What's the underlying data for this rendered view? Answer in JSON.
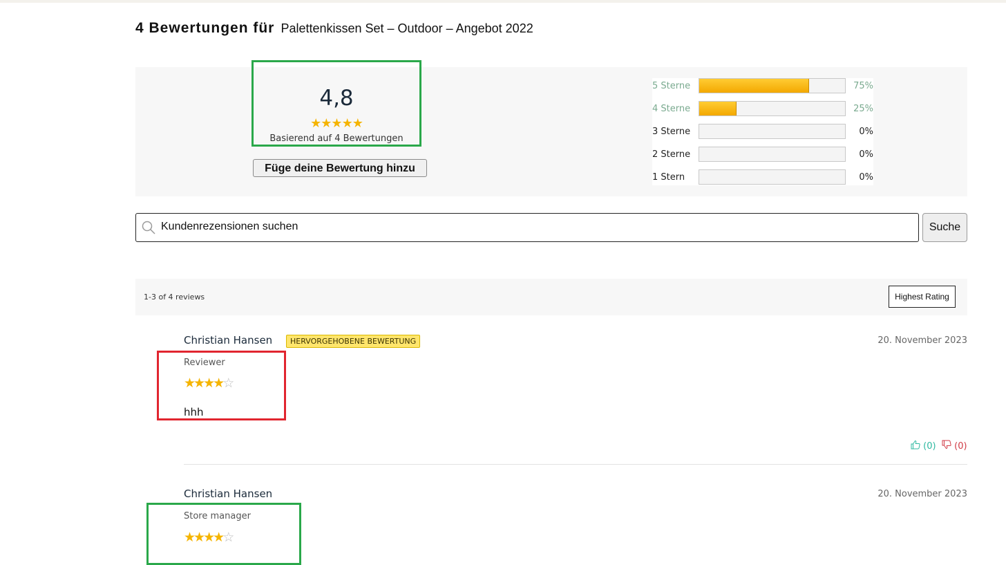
{
  "header": {
    "title_bold": "4 Bewertungen für",
    "product": "Palettenkissen Set – Outdoor – Angebot 2022"
  },
  "summary": {
    "average": "4,8",
    "average_stars": "★★★★★",
    "based_on": "Basierend auf 4 Bewertungen",
    "add_review_label": "Füge deine Bewertung hinzu",
    "distribution": [
      {
        "label": "5 Sterne",
        "percent": "75%",
        "fraction": 0.75,
        "active": true
      },
      {
        "label": "4 Sterne",
        "percent": "25%",
        "fraction": 0.25,
        "active": true
      },
      {
        "label": "3 Sterne",
        "percent": "0%",
        "fraction": 0,
        "active": false
      },
      {
        "label": "2 Sterne",
        "percent": "0%",
        "fraction": 0,
        "active": false
      },
      {
        "label": "1 Stern",
        "percent": "0%",
        "fraction": 0,
        "active": false
      }
    ]
  },
  "search": {
    "placeholder": "Kundenrezensionen suchen",
    "button_label": "Suche",
    "icon": "search-icon"
  },
  "list": {
    "count_text": "1-3 of 4 reviews",
    "sort_label": "Highest Rating"
  },
  "reviews": [
    {
      "author": "Christian Hansen",
      "badge": "HERVORGEHOBENE BEWERTUNG",
      "date": "20. November 2023",
      "role": "Reviewer",
      "rating": 4,
      "text": "hhh",
      "helpful_up": "(0)",
      "helpful_down": "(0)"
    },
    {
      "author": "Christian Hansen",
      "date": "20. November 2023",
      "role": "Store manager",
      "rating": 4
    }
  ],
  "colors": {
    "star": "#f5b400",
    "highlight_green": "#2aa84a",
    "highlight_red": "#e1252f",
    "vote_up": "#2db8a0",
    "vote_down": "#d03a44"
  }
}
